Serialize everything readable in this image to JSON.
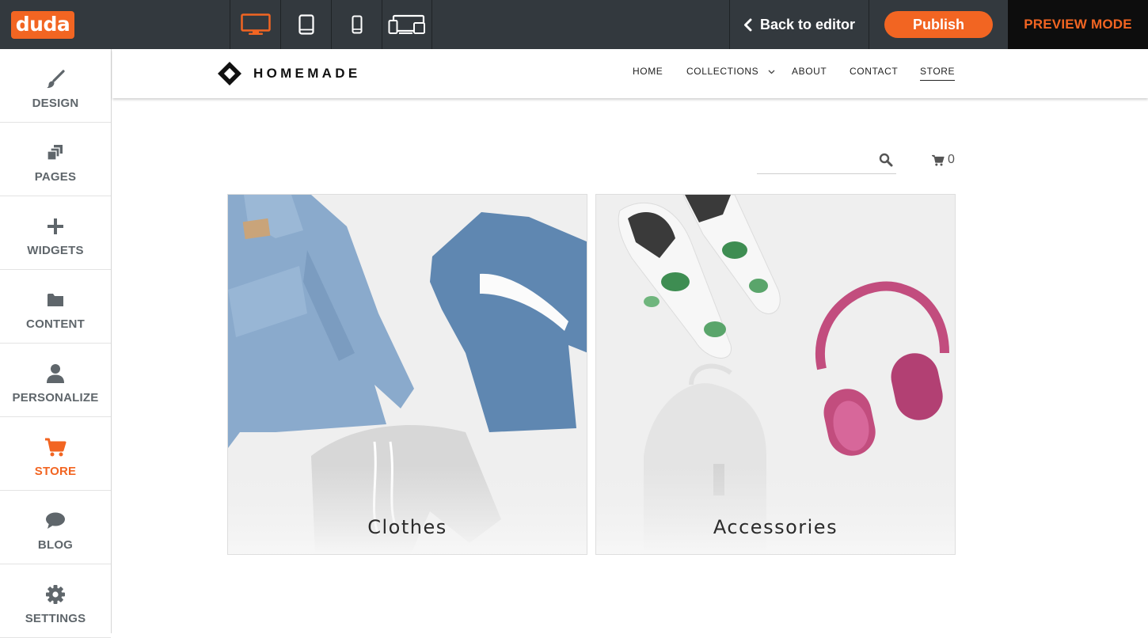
{
  "app": {
    "logo_text": "duda",
    "brand_color": "#f26522"
  },
  "topbar": {
    "devices": [
      "desktop-icon",
      "tablet-icon",
      "mobile-icon",
      "multi-device-icon"
    ],
    "selected_device": "desktop",
    "back_label": "Back to editor",
    "publish_label": "Publish",
    "mode_label": "PREVIEW MODE"
  },
  "sidebar": {
    "items": [
      {
        "label": "DESIGN",
        "icon": "brush-icon"
      },
      {
        "label": "PAGES",
        "icon": "pages-icon"
      },
      {
        "label": "WIDGETS",
        "icon": "plus-icon"
      },
      {
        "label": "CONTENT",
        "icon": "folder-icon"
      },
      {
        "label": "PERSONALIZE",
        "icon": "user-icon"
      },
      {
        "label": "STORE",
        "icon": "cart-icon"
      },
      {
        "label": "BLOG",
        "icon": "chat-bubble-icon"
      },
      {
        "label": "SETTINGS",
        "icon": "gear-icon"
      }
    ],
    "active": "STORE"
  },
  "site": {
    "brand_name": "HOMEMADE",
    "nav": [
      "HOME",
      "COLLECTIONS",
      "ABOUT",
      "CONTACT",
      "STORE"
    ],
    "active_nav": "STORE"
  },
  "store": {
    "search_placeholder": "",
    "cart_count": "0",
    "categories": [
      {
        "label": "Clothes"
      },
      {
        "label": "Accessories"
      }
    ]
  }
}
